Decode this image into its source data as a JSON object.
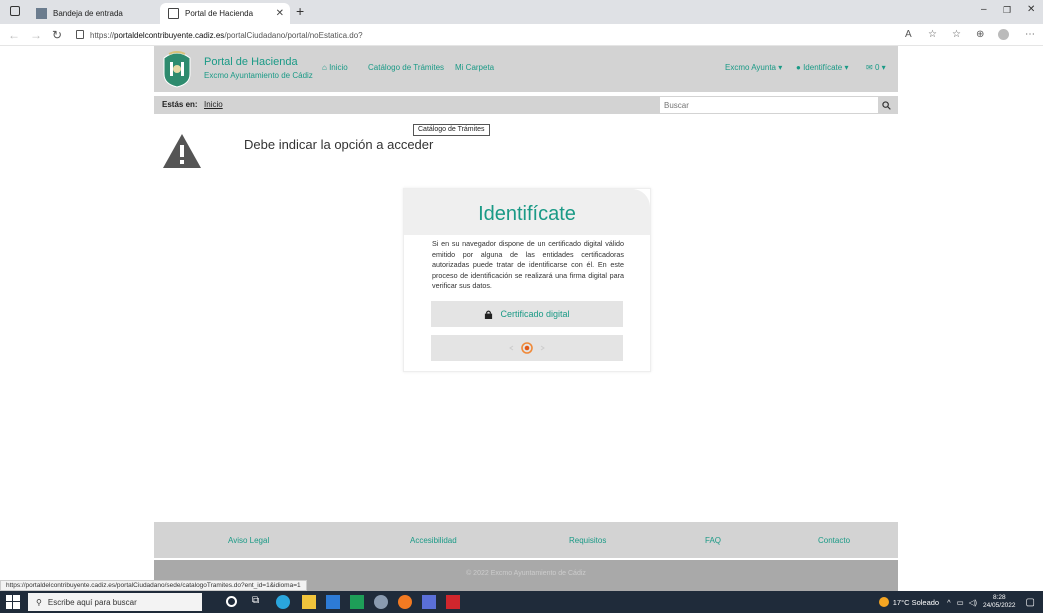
{
  "browser": {
    "tabs": [
      {
        "label": "Bandeja de entrada",
        "active": false
      },
      {
        "label": "Portal de Hacienda",
        "active": true
      }
    ],
    "url_prefix": "https://",
    "url_host": "portaldelcontribuyente.cadiz.es",
    "url_path": "/portalCiudadano/portal/noEstatica.do?"
  },
  "header": {
    "title": "Portal de Hacienda",
    "subtitle": "Excmo Ayuntamiento de Cádiz",
    "nav": {
      "inicio": "Inicio",
      "catalogo": "Catálogo de Trámites",
      "carpeta": "Mi Carpeta"
    },
    "tooltip": "Catálogo de Trámites",
    "right": {
      "ayunta": "Excmo Ayunta",
      "identificate": "Identifícate",
      "messages": "0"
    }
  },
  "breadcrumb": {
    "label": "Estás en:",
    "link": "Inicio"
  },
  "search": {
    "placeholder": "Buscar"
  },
  "warning": {
    "message": "Debe indicar la opción a acceder"
  },
  "login": {
    "title": "Identifícate",
    "text": "Si en su navegador dispone de un certificado digital válido emitido por alguna de las entidades certificadoras autorizadas puede tratar de identificarse con él. En este proceso de identificación se realizará una firma digital para verificar sus datos.",
    "cert_button": "Certificado digital"
  },
  "footer": {
    "links": [
      "Aviso Legal",
      "Accesibilidad",
      "Requisitos",
      "FAQ",
      "Contacto"
    ],
    "copyright": "© 2022 Excmo Ayuntamiento de Cádiz"
  },
  "status_url": "https://portaldelcontribuyente.cadiz.es/portalCiudadano/sede/catalogoTramites.do?ent_id=1&idioma=1",
  "taskbar": {
    "search_placeholder": "Escribe aquí para buscar",
    "weather": "17°C  Soleado",
    "time": "8:28",
    "date": "24/05/2022"
  },
  "colors": {
    "accent": "#1a9a86",
    "header_bg": "#d3d3d3"
  }
}
